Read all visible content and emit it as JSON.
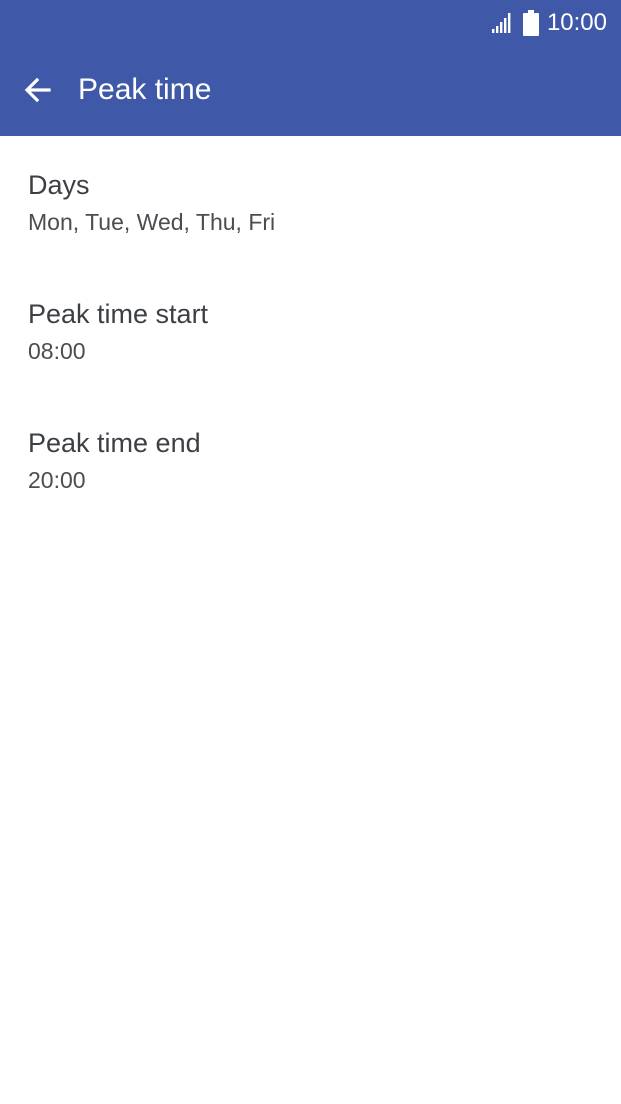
{
  "status_bar": {
    "time": "10:00",
    "signal_icon": "signal-icon",
    "battery_icon": "battery-icon"
  },
  "toolbar": {
    "back_icon": "back-arrow-icon",
    "title": "Peak time",
    "background": "#3f59a8"
  },
  "settings": [
    {
      "title": "Days",
      "value": "Mon, Tue, Wed, Thu, Fri"
    },
    {
      "title": "Peak time start",
      "value": "08:00"
    },
    {
      "title": "Peak time end",
      "value": "20:00"
    }
  ]
}
